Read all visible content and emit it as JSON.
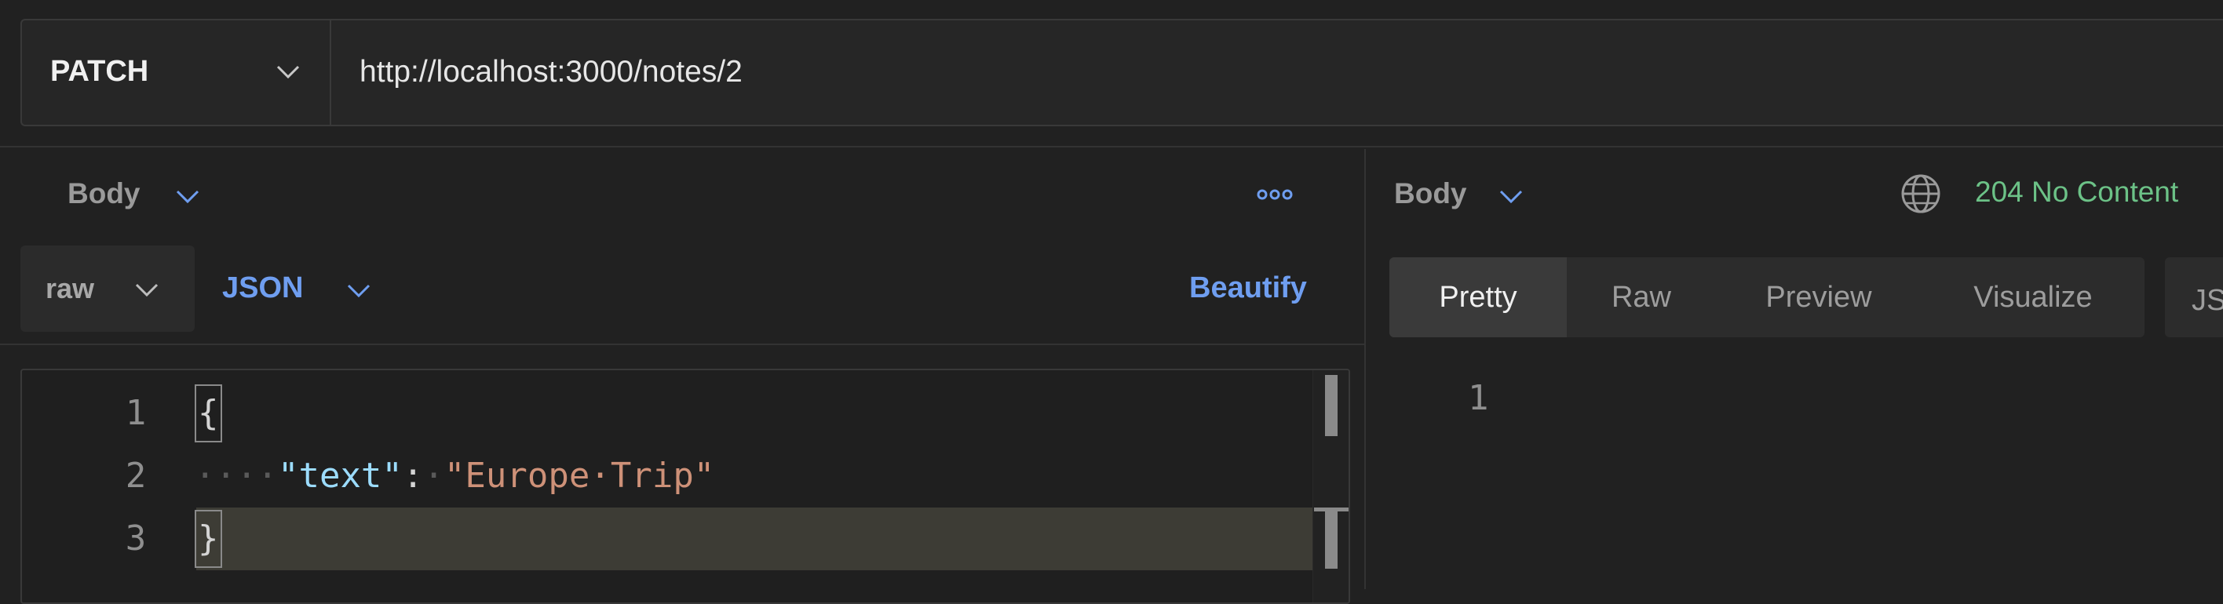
{
  "request": {
    "method": "PATCH",
    "url": "http://localhost:3000/notes/2"
  },
  "request_body": {
    "section_label": "Body",
    "mode": "raw",
    "language": "JSON",
    "beautify_label": "Beautify",
    "lines": [
      {
        "number": "1"
      },
      {
        "number": "2",
        "key": "\"text\"",
        "value": "\"Europe·Trip\""
      },
      {
        "number": "3"
      }
    ],
    "open_brace": "{",
    "close_brace": "}",
    "colon": ":",
    "indent_dots": "····",
    "space_dot": "·"
  },
  "response": {
    "section_label": "Body",
    "status": "204 No Content",
    "tabs": [
      {
        "label": "Pretty",
        "active": true
      },
      {
        "label": "Raw",
        "active": false
      },
      {
        "label": "Preview",
        "active": false
      },
      {
        "label": "Visualize",
        "active": false
      }
    ],
    "format_partial": "JS",
    "line_number": "1"
  },
  "icons": {
    "chevron": "chevron-down-icon",
    "more": "more-horizontal-icon",
    "globe": "globe-icon"
  },
  "colors": {
    "accent": "#6f9ef0",
    "status_ok": "#6cc287",
    "json_key": "#9cdcfe",
    "json_string": "#ce9178"
  }
}
